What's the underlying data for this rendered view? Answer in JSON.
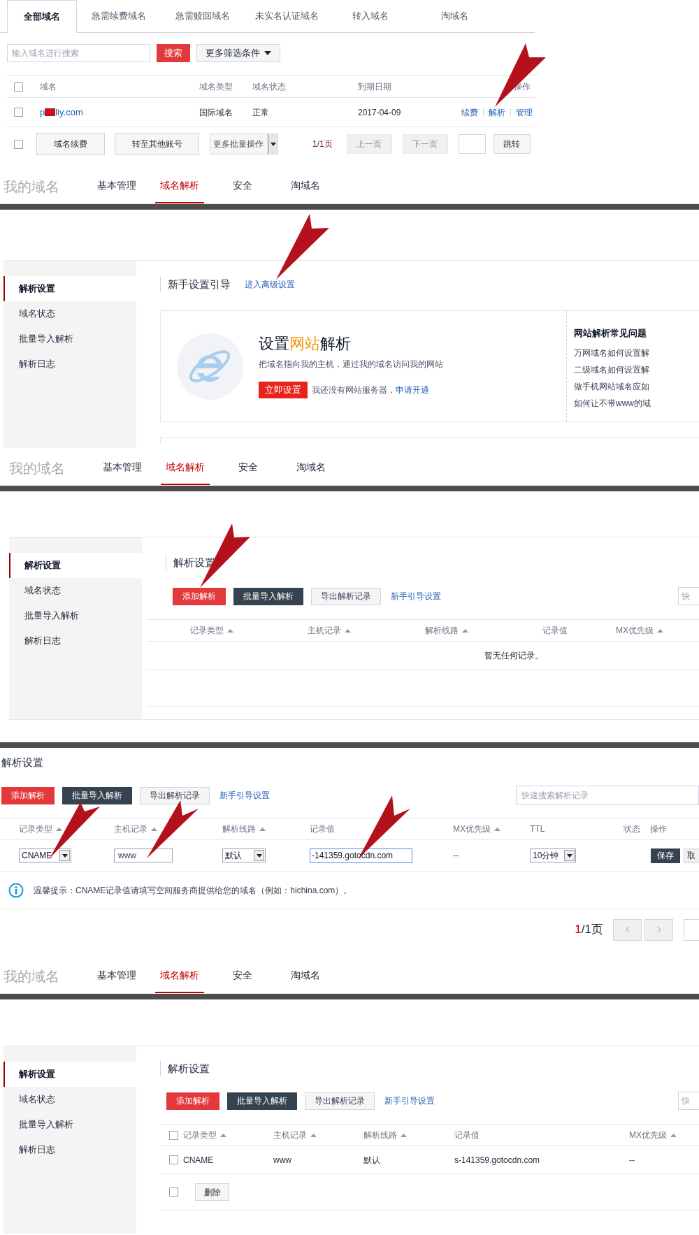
{
  "panels": [
    {
      "kind": "domain_list",
      "tabs": [
        {
          "label": "全部域名",
          "selected": true
        },
        {
          "label": "急需续费域名",
          "selected": false
        },
        {
          "label": "急需赎回域名",
          "selected": false
        },
        {
          "label": "未实名认证域名",
          "selected": false
        },
        {
          "label": "转入域名",
          "selected": false
        },
        {
          "label": "淘域名",
          "selected": false
        }
      ],
      "search": {
        "placeholder": "输入域名进行搜索"
      },
      "search_button": "搜索",
      "filter_button": "更多筛选条件",
      "select_all_checked": false,
      "columns": [
        "域名",
        "域名类型",
        "域名状态",
        "到期日期",
        "操作"
      ],
      "rows": [
        {
          "checked": false,
          "domain_parts": [
            "p",
            "liy.com"
          ],
          "type": "国际域名",
          "status": "正常",
          "expiry": "2017-04-09",
          "actions": [
            "续费",
            "解析",
            "管理"
          ]
        }
      ],
      "footer": {
        "checked": false,
        "buttons": [
          "域名续费",
          "转至其他账号"
        ],
        "batch_select": "更多批量操作",
        "page": "1/1页",
        "prev": {
          "label": "上一页",
          "disabled": true
        },
        "next": {
          "label": "下一页",
          "disabled": true
        },
        "jump": "跳转"
      },
      "nav": {
        "title": "我的域名",
        "items": [
          {
            "label": "基本管理",
            "selected": false
          },
          {
            "label": "域名解析",
            "selected": true
          },
          {
            "label": "安全",
            "selected": false
          },
          {
            "label": "淘域名",
            "selected": false
          }
        ]
      }
    },
    {
      "kind": "guide",
      "sidebar": [
        {
          "label": "解析设置",
          "selected": true
        },
        {
          "label": "域名状态",
          "selected": false
        },
        {
          "label": "批量导入解析",
          "selected": false
        },
        {
          "label": "解析日志",
          "selected": false
        }
      ],
      "heading": "新手设置引导",
      "advanced_link": "进入高级设置",
      "card": {
        "title": [
          {
            "text": "设置",
            "highlight": false
          },
          {
            "text": "网站",
            "highlight": true
          },
          {
            "text": "解析",
            "highlight": false
          }
        ],
        "subtitle": "把域名指向我的主机，通过我的域名访问我的网站",
        "button": "立即设置",
        "note": "我还没有网站服务器，",
        "note_link": "申请开通"
      },
      "faq": {
        "title": "网站解析常见问题",
        "items": [
          "万网域名如何设置解",
          "二级域名如何设置解",
          "做手机网站域名应如",
          "如何让不带www的域"
        ]
      },
      "nav": {
        "title": "我的域名",
        "items": [
          {
            "label": "基本管理",
            "selected": false
          },
          {
            "label": "域名解析",
            "selected": true
          },
          {
            "label": "安全",
            "selected": false
          },
          {
            "label": "淘域名",
            "selected": false
          }
        ]
      }
    },
    {
      "kind": "records_empty",
      "sidebar": [
        {
          "label": "解析设置",
          "selected": true
        },
        {
          "label": "域名状态",
          "selected": false
        },
        {
          "label": "批量导入解析",
          "selected": false
        },
        {
          "label": "解析日志",
          "selected": false
        }
      ],
      "heading": "解析设置",
      "buttons": [
        {
          "label": "添加解析",
          "kind": "primary"
        },
        {
          "label": "批量导入解析",
          "kind": "dark"
        },
        {
          "label": "导出解析记录",
          "kind": "default"
        }
      ],
      "guide_link": "新手引导设置",
      "search": {
        "placeholder": "快"
      },
      "columns": [
        {
          "label": "记录类型",
          "sortable": true
        },
        {
          "label": "主机记录",
          "sortable": true
        },
        {
          "label": "解析线路",
          "sortable": true
        },
        {
          "label": "记录值",
          "sortable": false
        },
        {
          "label": "MX优先级",
          "sortable": true
        }
      ],
      "empty": "暂无任何记录。"
    },
    {
      "kind": "record_edit",
      "heading": "解析设置",
      "buttons": [
        {
          "label": "添加解析",
          "kind": "primary"
        },
        {
          "label": "批量导入解析",
          "kind": "dark"
        },
        {
          "label": "导出解析记录",
          "kind": "default"
        }
      ],
      "guide_link": "新手引导设置",
      "search": {
        "placeholder": "快速搜索解析记录"
      },
      "columns": [
        {
          "label": "记录类型",
          "sortable": true
        },
        {
          "label": "主机记录",
          "sortable": true
        },
        {
          "label": "解析线路",
          "sortable": true
        },
        {
          "label": "记录值",
          "sortable": false
        },
        {
          "label": "MX优先级",
          "sortable": true
        },
        {
          "label": "TTL",
          "sortable": false
        },
        {
          "label": "状态",
          "sortable": false
        },
        {
          "label": "操作",
          "sortable": false
        }
      ],
      "edit_row": {
        "type": "CNAME",
        "host": "www",
        "line": "默认",
        "value": "-141359.gotocdn.com",
        "mx": "--",
        "ttl": "10分钟",
        "save": "保存",
        "cancel": "取"
      },
      "tip": "温馨提示：CNAME记录值请填写空间服务商提供给您的域名（例如：hichina.com）。",
      "page": {
        "current": "1",
        "total": "/1页"
      },
      "nav": {
        "title": "我的域名",
        "items": [
          {
            "label": "基本管理",
            "selected": false
          },
          {
            "label": "域名解析",
            "selected": true
          },
          {
            "label": "安全",
            "selected": false
          },
          {
            "label": "淘域名",
            "selected": false
          }
        ]
      }
    },
    {
      "kind": "records_list",
      "sidebar": [
        {
          "label": "解析设置",
          "selected": true
        },
        {
          "label": "域名状态",
          "selected": false
        },
        {
          "label": "批量导入解析",
          "selected": false
        },
        {
          "label": "解析日志",
          "selected": false
        }
      ],
      "heading": "解析设置",
      "buttons": [
        {
          "label": "添加解析",
          "kind": "primary"
        },
        {
          "label": "批量导入解析",
          "kind": "dark"
        },
        {
          "label": "导出解析记录",
          "kind": "default"
        }
      ],
      "guide_link": "新手引导设置",
      "search": {
        "placeholder": "快"
      },
      "select_all_checked": false,
      "columns": [
        {
          "label": "记录类型",
          "sortable": true
        },
        {
          "label": "主机记录",
          "sortable": true
        },
        {
          "label": "解析线路",
          "sortable": true
        },
        {
          "label": "记录值",
          "sortable": false
        },
        {
          "label": "MX优先级",
          "sortable": true
        }
      ],
      "rows": [
        {
          "checked": false,
          "cells": [
            "CNAME",
            "www",
            "默认",
            "s-141359.gotocdn.com",
            "--"
          ]
        }
      ],
      "footer_checked": false,
      "delete_button": "删除"
    }
  ]
}
